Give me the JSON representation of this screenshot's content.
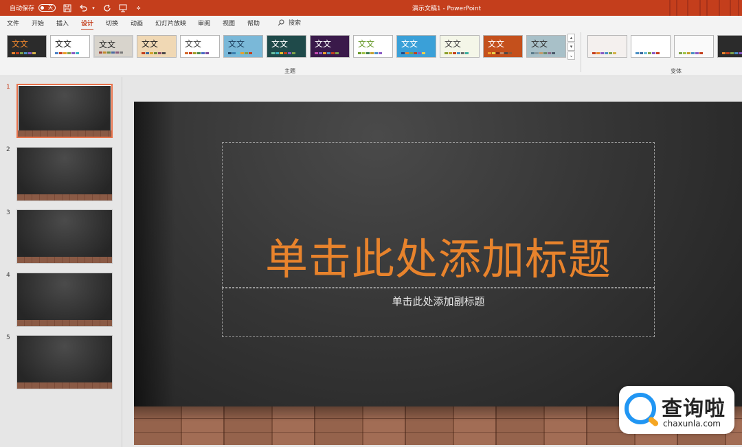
{
  "titlebar": {
    "autosave_label": "自动保存",
    "autosave_state": "关",
    "doc_title": "演示文稿1  -  PowerPoint"
  },
  "menu": {
    "tabs": [
      "文件",
      "开始",
      "插入",
      "设计",
      "切换",
      "动画",
      "幻灯片放映",
      "审阅",
      "视图",
      "帮助"
    ],
    "active": "设计",
    "search_label": "搜索"
  },
  "ribbon": {
    "themes_group_label": "主题",
    "variants_group_label": "变体",
    "theme_sample_text": "文文",
    "themes": [
      {
        "bg": "#2b2b2b",
        "fg": "#e8832c",
        "sw": [
          "#e8832c",
          "#c43e1c",
          "#7fa24a",
          "#4a8fc4",
          "#8a5ac4",
          "#d4b24a"
        ]
      },
      {
        "bg": "#ffffff",
        "fg": "#222222",
        "sw": [
          "#4a7fc4",
          "#c43e1c",
          "#e8a02c",
          "#7fa24a",
          "#8a5ac4",
          "#3ab0c4"
        ]
      },
      {
        "bg": "#d8d4cc",
        "fg": "#222222",
        "sw": [
          "#a0483c",
          "#c48a2c",
          "#6a8a4a",
          "#4a6aa0",
          "#8a5a7a",
          "#7a7a7a"
        ]
      },
      {
        "bg": "#f0d8b4",
        "fg": "#222222",
        "sw": [
          "#c43e1c",
          "#3a6aa0",
          "#d4a22c",
          "#6a8a3a",
          "#8a4a6a",
          "#4a4a4a"
        ]
      },
      {
        "bg": "#ffffff",
        "fg": "#444444",
        "sw": [
          "#d46a2c",
          "#c43e1c",
          "#a0a02c",
          "#4a8a4a",
          "#4a6ac4",
          "#7a4a9a"
        ]
      },
      {
        "bg": "#7ab8d8",
        "fg": "#1f4060",
        "sw": [
          "#1f4060",
          "#3a80b0",
          "#6ac0d8",
          "#e8a02c",
          "#7fa24a",
          "#c43e1c"
        ]
      },
      {
        "bg": "#1f4a4a",
        "fg": "#ffffff",
        "sw": [
          "#6ac0a0",
          "#3ab0c4",
          "#e8c02c",
          "#c43e1c",
          "#8a5ac4",
          "#7fa24a"
        ]
      },
      {
        "bg": "#3a1a4a",
        "fg": "#ffffff",
        "sw": [
          "#c44ab0",
          "#8a5ac4",
          "#e8a02c",
          "#4a8fc4",
          "#c43e1c",
          "#7fa24a"
        ]
      },
      {
        "bg": "#ffffff",
        "fg": "#6a9a2c",
        "sw": [
          "#6a9a2c",
          "#a0c44a",
          "#3a7a4a",
          "#c4a02c",
          "#4a8fc4",
          "#8a5ac4"
        ]
      },
      {
        "bg": "#3aa0d8",
        "fg": "#ffffff",
        "sw": [
          "#1f4a8a",
          "#e8832c",
          "#7fa24a",
          "#c43e1c",
          "#8a5ac4",
          "#f0d04a"
        ]
      },
      {
        "bg": "#f4f6e8",
        "fg": "#444444",
        "sw": [
          "#8aa02c",
          "#c4a02c",
          "#c43e1c",
          "#4a8fc4",
          "#6a6a6a",
          "#3ab0a0"
        ]
      },
      {
        "bg": "#c4501c",
        "fg": "#ffffff",
        "sw": [
          "#f0a02c",
          "#e8d04a",
          "#7a2a1a",
          "#c48a6a",
          "#4a4a4a",
          "#8a5a3a"
        ]
      },
      {
        "bg": "#a8c0c8",
        "fg": "#333333",
        "sw": [
          "#5a7a8a",
          "#8a9aa0",
          "#c49a6a",
          "#6a8a6a",
          "#8a6a8a",
          "#4a5a6a"
        ]
      }
    ],
    "variants": [
      {
        "bg": "#f4f0ee",
        "sw": [
          "#c43e1c",
          "#e8832c",
          "#8a5ac4",
          "#4a8fc4",
          "#7fa24a",
          "#d4b24a"
        ]
      },
      {
        "bg": "#ffffff",
        "sw": [
          "#4a8fc4",
          "#3a6aa0",
          "#6ac0d8",
          "#7fa24a",
          "#8a5ac4",
          "#c43e1c"
        ]
      },
      {
        "bg": "#fafafa",
        "sw": [
          "#7fa24a",
          "#a0c44a",
          "#c4a02c",
          "#4a8fc4",
          "#8a5ac4",
          "#c43e1c"
        ]
      },
      {
        "bg": "#2b2b2b",
        "sw": [
          "#e8832c",
          "#c43e1c",
          "#7fa24a",
          "#4a8fc4",
          "#8a5ac4",
          "#d4b24a"
        ]
      }
    ]
  },
  "slides_pane": {
    "numbers": [
      "1",
      "2",
      "3",
      "4",
      "5"
    ],
    "selected": 1
  },
  "slide": {
    "title_placeholder": "单击此处添加标题",
    "subtitle_placeholder": "单击此处添加副标题"
  },
  "watermark": {
    "text": "查询啦",
    "url": "chaxunla.com"
  }
}
